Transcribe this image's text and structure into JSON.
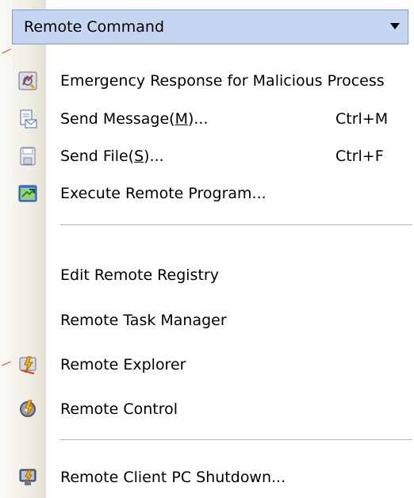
{
  "menu": {
    "title": "Remote Command",
    "items": [
      {
        "label": "Emergency Response for Malicious Process",
        "shortcut": "",
        "icon": "emergency-response-icon"
      },
      {
        "label": "Send Message(M)...",
        "shortcut": "Ctrl+M",
        "icon": "send-message-icon"
      },
      {
        "label": "Send File(S)...",
        "shortcut": "Ctrl+F",
        "icon": "send-file-icon"
      },
      {
        "label": "Execute Remote Program...",
        "shortcut": "",
        "icon": "execute-program-icon"
      },
      {
        "label": "Edit Remote Registry",
        "shortcut": "",
        "icon": ""
      },
      {
        "label": "Remote Task Manager",
        "shortcut": "",
        "icon": ""
      },
      {
        "label": "Remote Explorer",
        "shortcut": "",
        "icon": "remote-explorer-icon"
      },
      {
        "label": "Remote Control",
        "shortcut": "",
        "icon": "remote-control-icon"
      },
      {
        "label": "Remote Client PC Shutdown...",
        "shortcut": "",
        "icon": "shutdown-icon"
      }
    ]
  },
  "colors": {
    "header_bg": "#c6d6f2",
    "header_border": "#7f9db9",
    "separator": "#b9b6a7"
  }
}
